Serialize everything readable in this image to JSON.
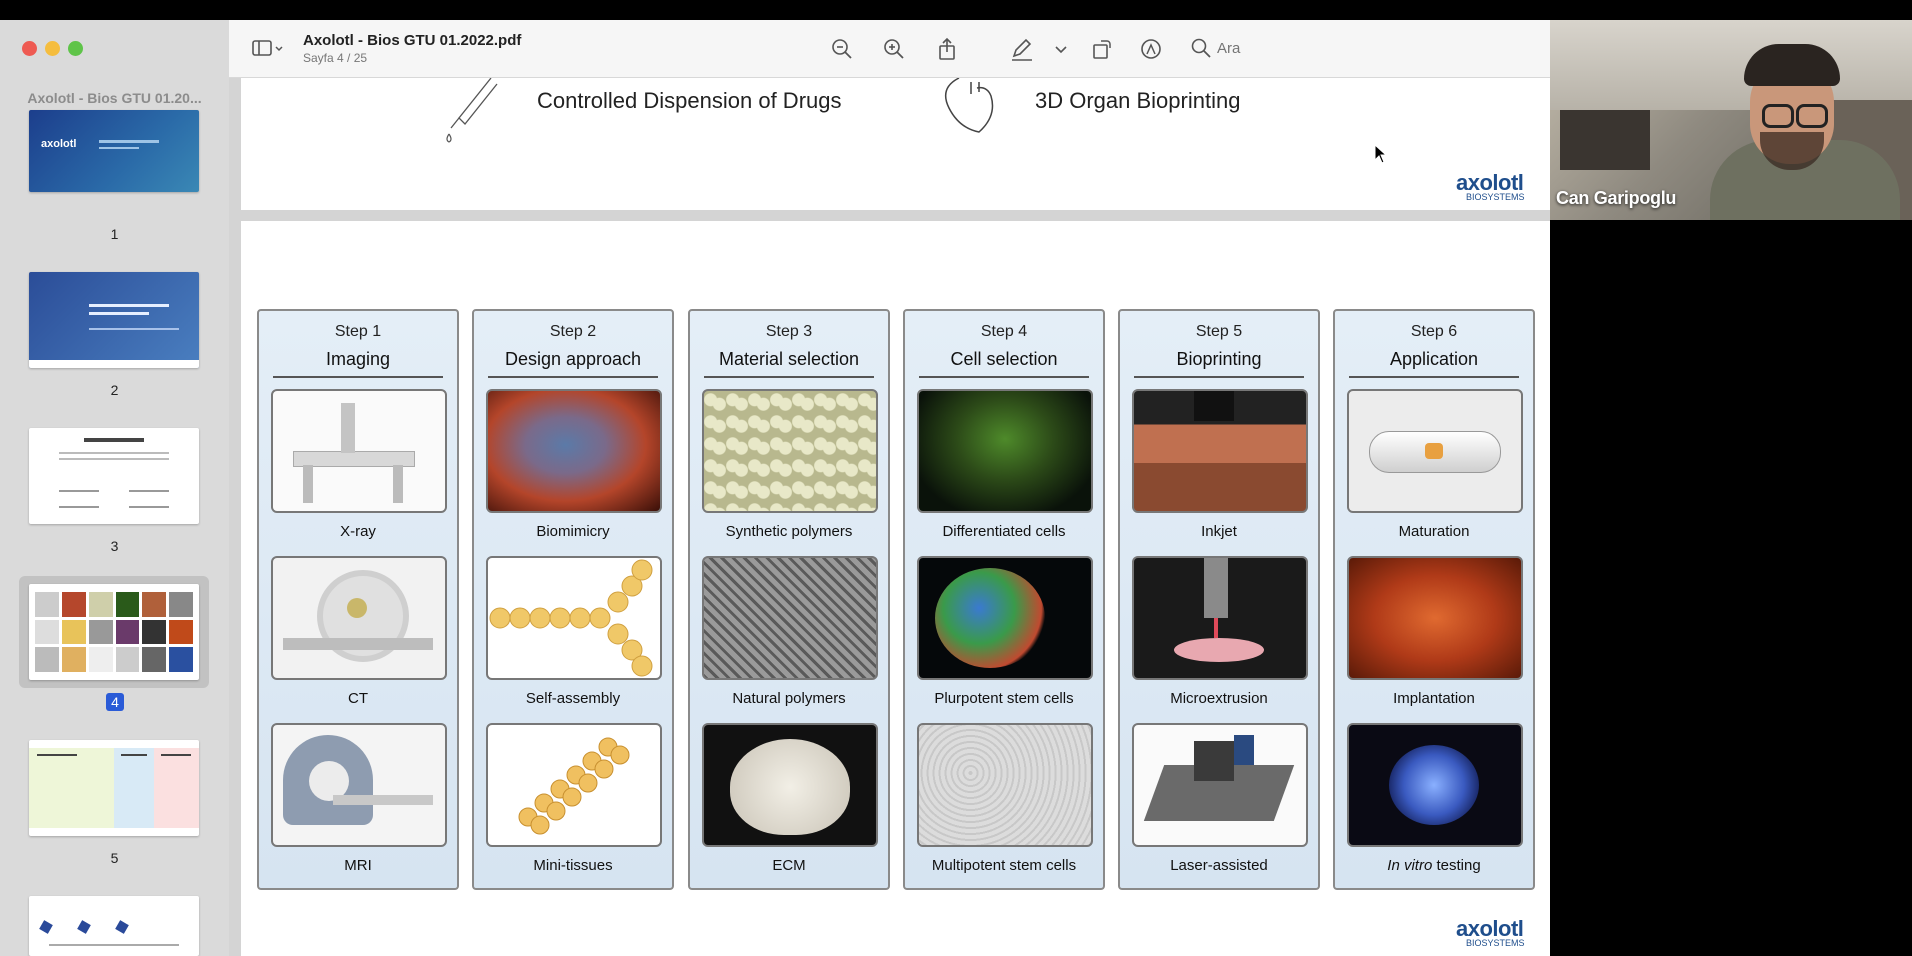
{
  "window": {
    "title": "Axolotl - Bios GTU 01.2022.pdf",
    "subtitle": "Sayfa 4 / 25",
    "search_placeholder": "Ara",
    "sidebar_title": "Axolotl - Bios GTU 01.20..."
  },
  "thumbnails": [
    {
      "label": "1",
      "selected": false
    },
    {
      "label": "2",
      "selected": false
    },
    {
      "label": "3",
      "selected": false
    },
    {
      "label": "4",
      "selected": true
    },
    {
      "label": "5",
      "selected": false
    },
    {
      "label": "",
      "selected": false
    }
  ],
  "page_top": {
    "item1": "Controlled Dispension of Drugs",
    "item2": "3D Organ Bioprinting",
    "logo_text": "axolotl",
    "logo_sub": "BIOSYSTEMS"
  },
  "steps": [
    {
      "num": "Step 1",
      "title": "Imaging",
      "items": [
        "X-ray",
        "CT",
        "MRI"
      ]
    },
    {
      "num": "Step 2",
      "title": "Design approach",
      "items": [
        "Biomimicry",
        "Self-assembly",
        "Mini-tissues"
      ]
    },
    {
      "num": "Step 3",
      "title": "Material selection",
      "items": [
        "Synthetic polymers",
        "Natural polymers",
        "ECM"
      ]
    },
    {
      "num": "Step 4",
      "title": "Cell selection",
      "items": [
        "Differentiated cells",
        "Plurpotent stem cells",
        "Multipotent stem cells"
      ]
    },
    {
      "num": "Step 5",
      "title": "Bioprinting",
      "items": [
        "Inkjet",
        "Microextrusion",
        "Laser-assisted"
      ]
    },
    {
      "num": "Step 6",
      "title": "Application",
      "items": [
        "Maturation",
        "Implantation",
        "In vitro testing"
      ]
    }
  ],
  "page_bottom": {
    "logo_text": "axolotl",
    "logo_sub": "BIOSYSTEMS"
  },
  "video": {
    "participant": "Can Garipoglu"
  },
  "colors": {
    "accent": "#2a5bd7",
    "close": "#ee5a52",
    "minimize": "#f5bd3e",
    "zoom": "#5fc449"
  }
}
